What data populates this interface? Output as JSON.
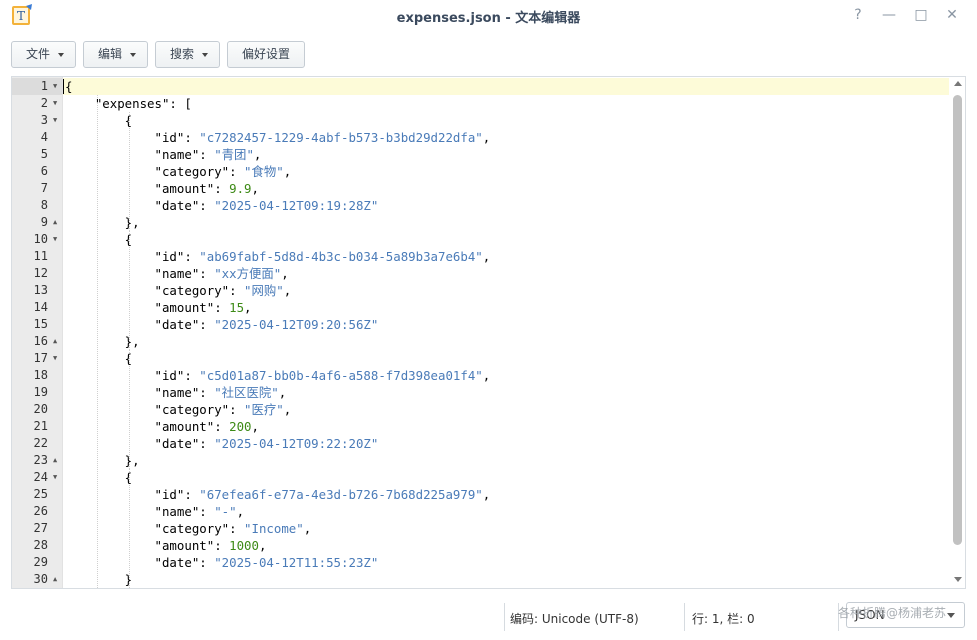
{
  "window": {
    "title": "expenses.json - 文本编辑器",
    "help_glyph": "?",
    "minimize_glyph": "—",
    "maximize_glyph": "□",
    "close_glyph": "✕"
  },
  "toolbar": {
    "file": "文件",
    "edit": "编辑",
    "search": "搜索",
    "preferences": "偏好设置"
  },
  "editor": {
    "lines": [
      {
        "n": "1",
        "fold": "down",
        "segs": [
          {
            "t": "{",
            "c": "key"
          }
        ]
      },
      {
        "n": "2",
        "fold": "down",
        "segs": [
          {
            "t": "    \"expenses\": [",
            "c": "key"
          }
        ]
      },
      {
        "n": "3",
        "fold": "down",
        "segs": [
          {
            "t": "        {",
            "c": "key"
          }
        ]
      },
      {
        "n": "4",
        "segs": [
          {
            "t": "            \"id\": ",
            "c": "key"
          },
          {
            "t": "\"c7282457-1229-4abf-b573-b3bd29d22dfa\"",
            "c": "str"
          },
          {
            "t": ",",
            "c": "key"
          }
        ]
      },
      {
        "n": "5",
        "segs": [
          {
            "t": "            \"name\": ",
            "c": "key"
          },
          {
            "t": "\"青团\"",
            "c": "str"
          },
          {
            "t": ",",
            "c": "key"
          }
        ]
      },
      {
        "n": "6",
        "segs": [
          {
            "t": "            \"category\": ",
            "c": "key"
          },
          {
            "t": "\"食物\"",
            "c": "str"
          },
          {
            "t": ",",
            "c": "key"
          }
        ]
      },
      {
        "n": "7",
        "segs": [
          {
            "t": "            \"amount\": ",
            "c": "key"
          },
          {
            "t": "9.9",
            "c": "num"
          },
          {
            "t": ",",
            "c": "key"
          }
        ]
      },
      {
        "n": "8",
        "segs": [
          {
            "t": "            \"date\": ",
            "c": "key"
          },
          {
            "t": "\"2025-04-12T09:19:28Z\"",
            "c": "str"
          }
        ]
      },
      {
        "n": "9",
        "fold": "up",
        "segs": [
          {
            "t": "        },",
            "c": "key"
          }
        ]
      },
      {
        "n": "10",
        "fold": "down",
        "segs": [
          {
            "t": "        {",
            "c": "key"
          }
        ]
      },
      {
        "n": "11",
        "segs": [
          {
            "t": "            \"id\": ",
            "c": "key"
          },
          {
            "t": "\"ab69fabf-5d8d-4b3c-b034-5a89b3a7e6b4\"",
            "c": "str"
          },
          {
            "t": ",",
            "c": "key"
          }
        ]
      },
      {
        "n": "12",
        "segs": [
          {
            "t": "            \"name\": ",
            "c": "key"
          },
          {
            "t": "\"xx方便面\"",
            "c": "str"
          },
          {
            "t": ",",
            "c": "key"
          }
        ]
      },
      {
        "n": "13",
        "segs": [
          {
            "t": "            \"category\": ",
            "c": "key"
          },
          {
            "t": "\"网购\"",
            "c": "str"
          },
          {
            "t": ",",
            "c": "key"
          }
        ]
      },
      {
        "n": "14",
        "segs": [
          {
            "t": "            \"amount\": ",
            "c": "key"
          },
          {
            "t": "15",
            "c": "num"
          },
          {
            "t": ",",
            "c": "key"
          }
        ]
      },
      {
        "n": "15",
        "segs": [
          {
            "t": "            \"date\": ",
            "c": "key"
          },
          {
            "t": "\"2025-04-12T09:20:56Z\"",
            "c": "str"
          }
        ]
      },
      {
        "n": "16",
        "fold": "up",
        "segs": [
          {
            "t": "        },",
            "c": "key"
          }
        ]
      },
      {
        "n": "17",
        "fold": "down",
        "segs": [
          {
            "t": "        {",
            "c": "key"
          }
        ]
      },
      {
        "n": "18",
        "segs": [
          {
            "t": "            \"id\": ",
            "c": "key"
          },
          {
            "t": "\"c5d01a87-bb0b-4af6-a588-f7d398ea01f4\"",
            "c": "str"
          },
          {
            "t": ",",
            "c": "key"
          }
        ]
      },
      {
        "n": "19",
        "segs": [
          {
            "t": "            \"name\": ",
            "c": "key"
          },
          {
            "t": "\"社区医院\"",
            "c": "str"
          },
          {
            "t": ",",
            "c": "key"
          }
        ]
      },
      {
        "n": "20",
        "segs": [
          {
            "t": "            \"category\": ",
            "c": "key"
          },
          {
            "t": "\"医疗\"",
            "c": "str"
          },
          {
            "t": ",",
            "c": "key"
          }
        ]
      },
      {
        "n": "21",
        "segs": [
          {
            "t": "            \"amount\": ",
            "c": "key"
          },
          {
            "t": "200",
            "c": "num"
          },
          {
            "t": ",",
            "c": "key"
          }
        ]
      },
      {
        "n": "22",
        "segs": [
          {
            "t": "            \"date\": ",
            "c": "key"
          },
          {
            "t": "\"2025-04-12T09:22:20Z\"",
            "c": "str"
          }
        ]
      },
      {
        "n": "23",
        "fold": "up",
        "segs": [
          {
            "t": "        },",
            "c": "key"
          }
        ]
      },
      {
        "n": "24",
        "fold": "down",
        "segs": [
          {
            "t": "        {",
            "c": "key"
          }
        ]
      },
      {
        "n": "25",
        "segs": [
          {
            "t": "            \"id\": ",
            "c": "key"
          },
          {
            "t": "\"67efea6f-e77a-4e3d-b726-7b68d225a979\"",
            "c": "str"
          },
          {
            "t": ",",
            "c": "key"
          }
        ]
      },
      {
        "n": "26",
        "segs": [
          {
            "t": "            \"name\": ",
            "c": "key"
          },
          {
            "t": "\"-\"",
            "c": "str"
          },
          {
            "t": ",",
            "c": "key"
          }
        ]
      },
      {
        "n": "27",
        "segs": [
          {
            "t": "            \"category\": ",
            "c": "key"
          },
          {
            "t": "\"Income\"",
            "c": "str"
          },
          {
            "t": ",",
            "c": "key"
          }
        ]
      },
      {
        "n": "28",
        "segs": [
          {
            "t": "            \"amount\": ",
            "c": "key"
          },
          {
            "t": "1000",
            "c": "num"
          },
          {
            "t": ",",
            "c": "key"
          }
        ]
      },
      {
        "n": "29",
        "segs": [
          {
            "t": "            \"date\": ",
            "c": "key"
          },
          {
            "t": "\"2025-04-12T11:55:23Z\"",
            "c": "str"
          }
        ]
      },
      {
        "n": "30",
        "fold": "up",
        "segs": [
          {
            "t": "        }",
            "c": "key"
          }
        ]
      }
    ],
    "active_line": 1
  },
  "status": {
    "encoding": "编码: Unicode (UTF-8)",
    "position": "行: 1, 栏: 0",
    "language": "JSON",
    "watermark": "各种折腾@杨浦老苏"
  },
  "colors": {
    "string": "#4a7bb8",
    "number": "#3d8a16",
    "active_line_bg": "#fdfbd8",
    "gutter_bg": "#ebebeb"
  }
}
